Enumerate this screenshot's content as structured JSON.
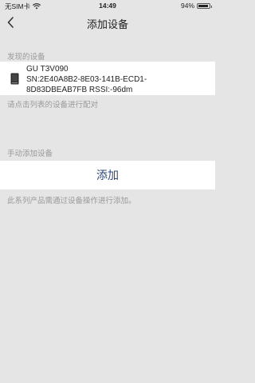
{
  "status_bar": {
    "carrier": "无SIM卡",
    "time": "14:49",
    "battery_percent": "94%",
    "battery_level": 0.94
  },
  "nav": {
    "title": "添加设备",
    "back_icon": "chevron-left-icon"
  },
  "discovered": {
    "header": "发现的设备",
    "devices": [
      {
        "name": "GU T3V090",
        "sn_line1": "SN:2E40A8B2-8E03-141B-ECD1-",
        "sn_line2": "8D83DBEAB7FB RSSI:-96dm",
        "icon": "device-icon"
      }
    ],
    "hint": "请点击列表的设备进行配对"
  },
  "manual": {
    "header": "手动添加设备",
    "add_label": "添加",
    "note": "此系列产品需通过设备操作进行添加。"
  }
}
